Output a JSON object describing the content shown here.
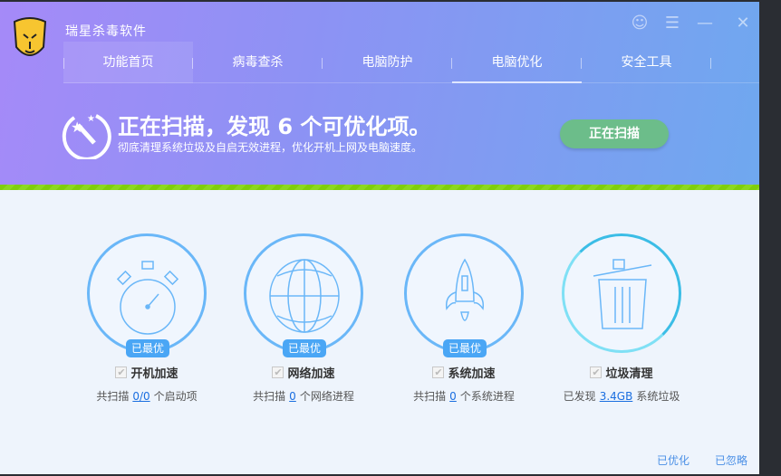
{
  "app": {
    "title": "瑞星杀毒软件"
  },
  "tabs": [
    {
      "label": "功能首页"
    },
    {
      "label": "病毒查杀"
    },
    {
      "label": "电脑防护"
    },
    {
      "label": "电脑优化"
    },
    {
      "label": "安全工具"
    }
  ],
  "banner": {
    "headline": "正在扫描，发现 6 个可优化项。",
    "subline": "彻底清理系统垃圾及自启无效进程，优化开机上网及电脑速度。",
    "button": "正在扫描"
  },
  "cards": [
    {
      "title": "开机加速",
      "badge": "已最优",
      "prefix": "共扫描",
      "value": "0/0",
      "suffix": "个启动项"
    },
    {
      "title": "网络加速",
      "badge": "已最优",
      "prefix": "共扫描",
      "value": "0",
      "suffix": "个网络进程"
    },
    {
      "title": "系统加速",
      "badge": "已最优",
      "prefix": "共扫描",
      "value": "0",
      "suffix": "个系统进程"
    },
    {
      "title": "垃圾清理",
      "prefix": "已发现",
      "value": "3.4GB",
      "suffix": "系统垃圾"
    }
  ],
  "footer": {
    "optimized": "已优化",
    "ignored": "已忽略"
  },
  "colors": {
    "accent": "#4aa6f5",
    "progress": "#7fce0b",
    "button": "#6cbd8a"
  }
}
